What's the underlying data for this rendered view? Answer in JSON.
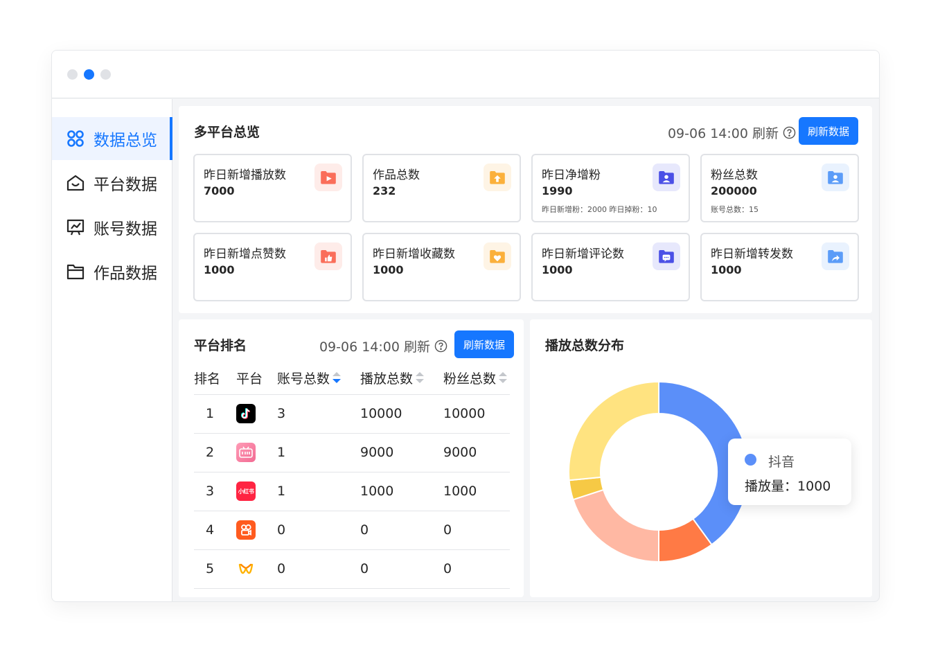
{
  "window": {
    "dots": [
      "inactive",
      "active",
      "inactive"
    ]
  },
  "sidebar": {
    "items": [
      {
        "label": "数据总览",
        "icon": "overview-icon",
        "active": true
      },
      {
        "label": "平台数据",
        "icon": "home-icon",
        "active": false
      },
      {
        "label": "账号数据",
        "icon": "account-board-icon",
        "active": false
      },
      {
        "label": "作品数据",
        "icon": "folder-icon",
        "active": false
      }
    ]
  },
  "overview": {
    "title": "多平台总览",
    "refresh_time": "09-06 14:00 刷新",
    "refresh_button": "刷新数据",
    "cards": [
      {
        "label": "昨日新增播放数",
        "value": "7000",
        "sub": "",
        "icon": "play-folder-icon",
        "color": "#fa6e5a"
      },
      {
        "label": "作品总数",
        "value": "232",
        "sub": "",
        "icon": "upload-folder-icon",
        "color": "#fbb03b"
      },
      {
        "label": "昨日净增粉",
        "value": "1990",
        "sub": "昨日新增粉：2000    昨日掉粉：10",
        "icon": "user-folder-icon",
        "color": "#4b50e6"
      },
      {
        "label": "粉丝总数",
        "value": "200000",
        "sub": "账号总数：15",
        "icon": "user-folder-icon",
        "color": "#5b9cf8"
      },
      {
        "label": "昨日新增点赞数",
        "value": "1000",
        "sub": "",
        "icon": "like-folder-icon",
        "color": "#fa6e5a"
      },
      {
        "label": "昨日新增收藏数",
        "value": "1000",
        "sub": "",
        "icon": "heart-folder-icon",
        "color": "#fbb03b"
      },
      {
        "label": "昨日新增评论数",
        "value": "1000",
        "sub": "",
        "icon": "comment-folder-icon",
        "color": "#4b50e6"
      },
      {
        "label": "昨日新增转发数",
        "value": "1000",
        "sub": "",
        "icon": "share-folder-icon",
        "color": "#5b9cf8"
      }
    ]
  },
  "ranking": {
    "title": "平台排名",
    "refresh_time": "09-06 14:00 刷新",
    "refresh_button": "刷新数据",
    "columns": [
      "排名",
      "平台",
      "账号总数",
      "播放总数",
      "粉丝总数"
    ],
    "rows": [
      {
        "rank": "1",
        "platform_icon": "douyin-logo",
        "accounts": "3",
        "plays": "10000",
        "fans": "10000"
      },
      {
        "rank": "2",
        "platform_icon": "bilibili-logo",
        "accounts": "1",
        "plays": "9000",
        "fans": "9000"
      },
      {
        "rank": "3",
        "platform_icon": "xiaohongshu-logo",
        "accounts": "1",
        "plays": "1000",
        "fans": "1000"
      },
      {
        "rank": "4",
        "platform_icon": "kuaishou-logo",
        "accounts": "0",
        "plays": "0",
        "fans": "0"
      },
      {
        "rank": "5",
        "platform_icon": "weishi-logo",
        "accounts": "0",
        "plays": "0",
        "fans": "0"
      }
    ],
    "xhs_logo_text": "小红书"
  },
  "distribution": {
    "title": "播放总数分布",
    "tooltip": {
      "name": "抖音",
      "label": "播放量：",
      "value": "1000",
      "color": "#5b8ff9"
    }
  },
  "chart_data": {
    "type": "pie",
    "donut": true,
    "title": "播放总数分布",
    "slices": [
      {
        "value": 40,
        "color": "#5b8ff9"
      },
      {
        "value": 10,
        "color": "#ff7a45"
      },
      {
        "value": 20,
        "color": "#ffb8a3"
      },
      {
        "value": 3.5,
        "color": "#f6c945"
      },
      {
        "value": 26.5,
        "color": "#ffe380"
      }
    ]
  }
}
